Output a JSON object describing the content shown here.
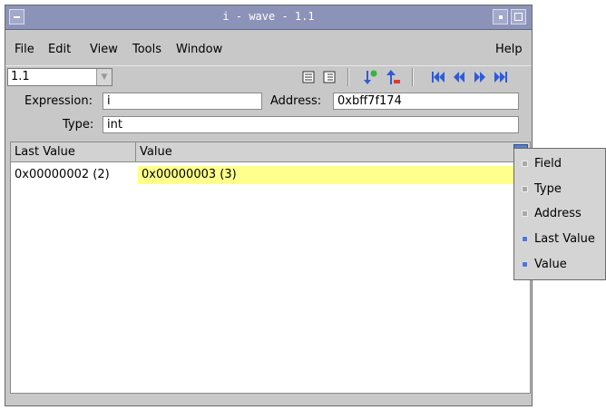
{
  "window": {
    "title": "i - wave - 1.1"
  },
  "menu": [
    {
      "label": "File"
    },
    {
      "label": "Edit"
    },
    {
      "label": "View"
    },
    {
      "label": "Tools"
    },
    {
      "label": "Window"
    },
    {
      "label": "Help"
    }
  ],
  "toolbar": {
    "combo_value": "1.1",
    "icons": [
      "list-icon",
      "list-alt-icon",
      "push-icon",
      "pop-icon",
      "first-icon",
      "back-icon",
      "forward-icon",
      "last-icon"
    ]
  },
  "expression": {
    "label": "Expression:",
    "value": "i"
  },
  "address": {
    "label": "Address:",
    "value": "0xbff7f174"
  },
  "type": {
    "label": "Type:",
    "value": "int"
  },
  "table": {
    "columns": [
      "Last Value",
      "Value"
    ],
    "rows": [
      {
        "last_value": "0x00000002 (2)",
        "value": "0x00000003 (3)"
      }
    ]
  },
  "popup_menu": {
    "items": [
      {
        "label": "Field",
        "checked": false
      },
      {
        "label": "Type",
        "checked": false
      },
      {
        "label": "Address",
        "checked": false
      },
      {
        "label": "Last Value",
        "checked": true
      },
      {
        "label": "Value",
        "checked": true
      }
    ]
  },
  "colors": {
    "title_bar": "#8c93b8",
    "highlight": "#ffff8c",
    "icon_blue": "#2f5bd8"
  }
}
